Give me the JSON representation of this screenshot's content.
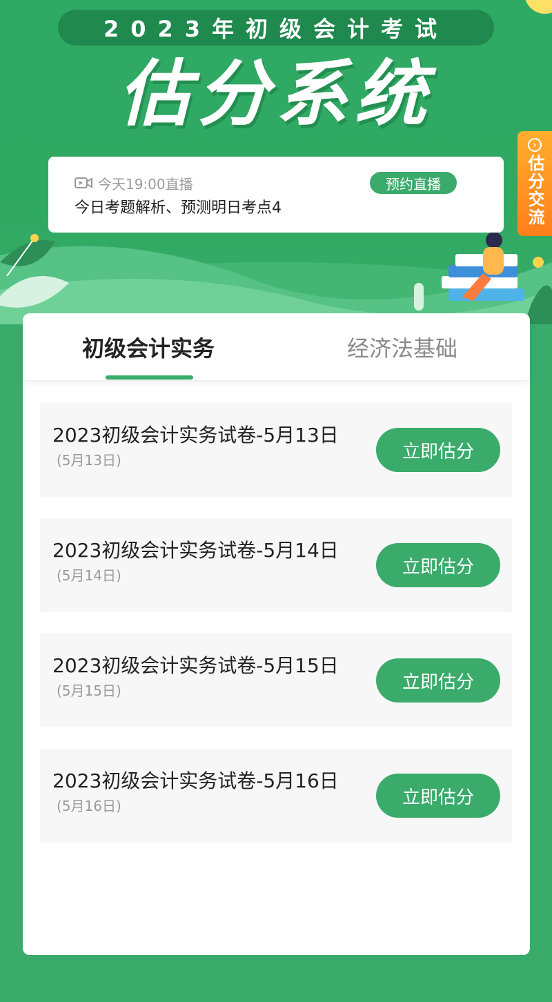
{
  "header": {
    "subtitle": "2023年初级会计考试",
    "title": "估分系统"
  },
  "live": {
    "time": "今天19:00直播",
    "description": "今日考题解析、预测明日考点4",
    "reserve_label": "预约直播"
  },
  "side_tab": {
    "label": "估分交流",
    "icon": "chevron-right-circle-icon"
  },
  "tabs": [
    {
      "label": "初级会计实务",
      "active": true
    },
    {
      "label": "经济法基础",
      "active": false
    }
  ],
  "exams": [
    {
      "title": "2023初级会计实务试卷-5月13日",
      "date": "(5月13日)",
      "button": "立即估分"
    },
    {
      "title": "2023初级会计实务试卷-5月14日",
      "date": "(5月14日)",
      "button": "立即估分"
    },
    {
      "title": "2023初级会计实务试卷-5月15日",
      "date": "(5月15日)",
      "button": "立即估分"
    },
    {
      "title": "2023初级会计实务试卷-5月16日",
      "date": "(5月16日)",
      "button": "立即估分"
    }
  ],
  "colors": {
    "brand_green": "#3aab6b",
    "side_tab_orange": "#ff8c1a"
  }
}
